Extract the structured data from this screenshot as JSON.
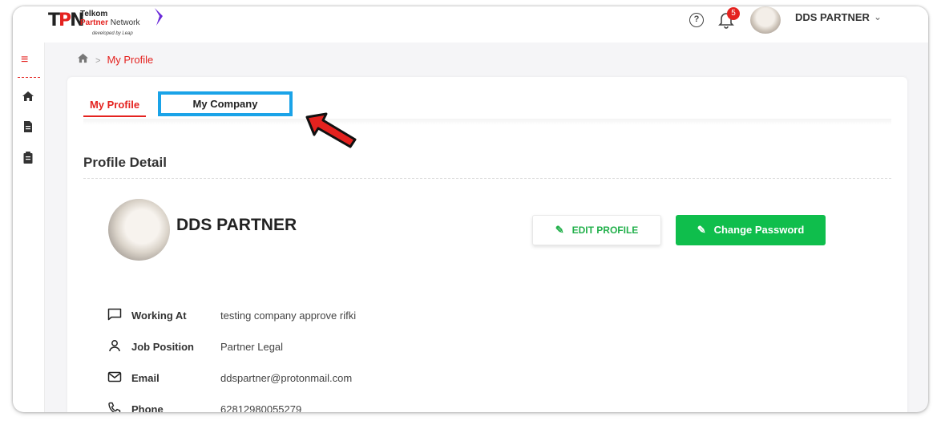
{
  "header": {
    "logo_mark_t": "T",
    "logo_mark_p": "P",
    "logo_mark_n": "N",
    "logo_line1": "Telkom",
    "logo_line2_a": "Partner",
    "logo_line2_b": " Network",
    "logo_line3": "developed by Leap",
    "help_icon": "question-circle-icon",
    "notification_count": "5",
    "username": "DDS PARTNER",
    "chevron": "chevron-down-icon"
  },
  "sidebar": {
    "menu_icon": "hamburger-icon",
    "items": [
      {
        "icon": "home-icon"
      },
      {
        "icon": "document-icon"
      },
      {
        "icon": "clipboard-icon"
      }
    ]
  },
  "breadcrumb": {
    "current": "My Profile"
  },
  "tabs": [
    {
      "label": "My Profile",
      "active": true
    },
    {
      "label": "My Company",
      "active": false
    }
  ],
  "profile": {
    "section_title": "Profile Detail",
    "name": "DDS PARTNER",
    "edit_button": "EDIT PROFILE",
    "password_button": "Change Password",
    "fields": [
      {
        "icon": "message-icon",
        "label": "Working At",
        "value": "testing company approve rifki"
      },
      {
        "icon": "user-icon",
        "label": "Job Position",
        "value": "Partner Legal"
      },
      {
        "icon": "mail-icon",
        "label": "Email",
        "value": "ddspartner@protonmail.com"
      },
      {
        "icon": "phone-icon",
        "label": "Phone",
        "value": "62812980055279"
      }
    ]
  },
  "colors": {
    "accent_red": "#e4221f",
    "green": "#0fbe4c",
    "highlight_blue": "#1aa3e8"
  }
}
